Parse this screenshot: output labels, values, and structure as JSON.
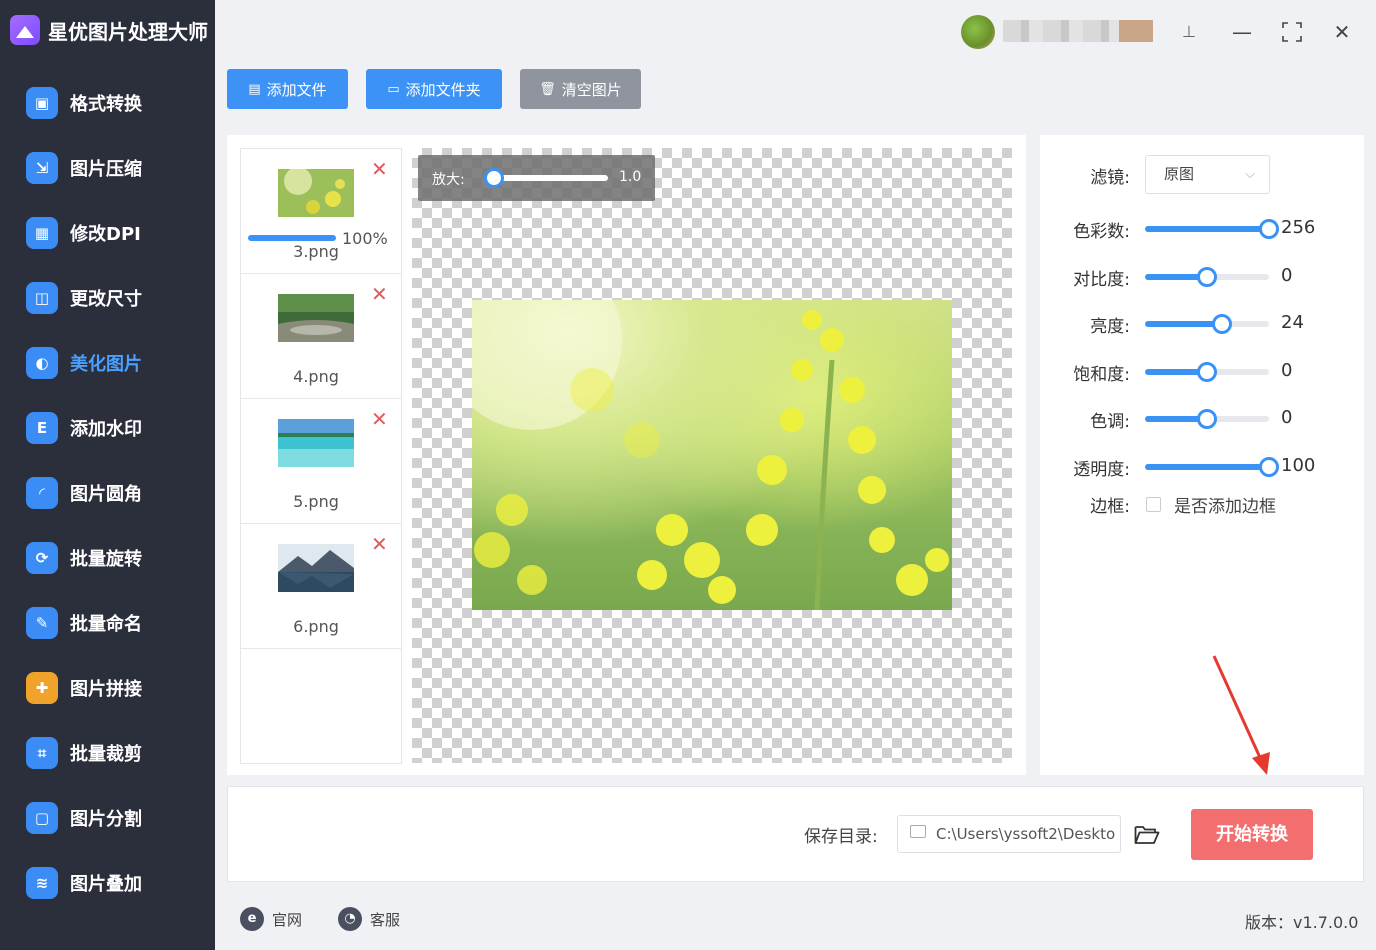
{
  "app": {
    "title": "星优图片处理大师"
  },
  "sidebar": {
    "items": [
      {
        "label": "格式转换",
        "icon": "image-convert-icon",
        "color": "#3b8df5",
        "glyph": "▣"
      },
      {
        "label": "图片压缩",
        "icon": "compress-icon",
        "color": "#3b8df5",
        "glyph": "⇲"
      },
      {
        "label": "修改DPI",
        "icon": "dpi-icon",
        "color": "#3b8df5",
        "glyph": "▦"
      },
      {
        "label": "更改尺寸",
        "icon": "resize-icon",
        "color": "#3b8df5",
        "glyph": "◫"
      },
      {
        "label": "美化图片",
        "icon": "beautify-icon",
        "color": "#3b8df5",
        "glyph": "◐"
      },
      {
        "label": "添加水印",
        "icon": "watermark-icon",
        "color": "#3b8df5",
        "glyph": "E"
      },
      {
        "label": "图片圆角",
        "icon": "rounded-corner-icon",
        "color": "#3b8df5",
        "glyph": "◜"
      },
      {
        "label": "批量旋转",
        "icon": "rotate-icon",
        "color": "#3b8df5",
        "glyph": "⟳"
      },
      {
        "label": "批量命名",
        "icon": "rename-icon",
        "color": "#3b8df5",
        "glyph": "✎"
      },
      {
        "label": "图片拼接",
        "icon": "puzzle-icon",
        "color": "#f0a32a",
        "glyph": "✚"
      },
      {
        "label": "批量裁剪",
        "icon": "crop-icon",
        "color": "#3b8df5",
        "glyph": "⌗"
      },
      {
        "label": "图片分割",
        "icon": "split-icon",
        "color": "#3b8df5",
        "glyph": "▢"
      },
      {
        "label": "图片叠加",
        "icon": "layers-icon",
        "color": "#3b8df5",
        "glyph": "≋"
      }
    ],
    "active_index": 4
  },
  "toolbar": {
    "add_file": "添加文件",
    "add_folder": "添加文件夹",
    "clear": "清空图片",
    "primary_color": "#3d93f5",
    "clear_color": "#8f949e"
  },
  "files": [
    {
      "name": "3.png",
      "progress_text": "100%",
      "progress": 1.0,
      "thumb": "flowers"
    },
    {
      "name": "4.png",
      "thumb": "river"
    },
    {
      "name": "5.png",
      "thumb": "beach"
    },
    {
      "name": "6.png",
      "thumb": "mountain"
    }
  ],
  "preview": {
    "zoom_label": "放大:",
    "zoom_value": "1.0"
  },
  "settings": {
    "filter_label": "滤镜:",
    "filter_value": "原图",
    "sliders": [
      {
        "label": "色彩数:",
        "value": "256",
        "fraction": 1.0
      },
      {
        "label": "对比度:",
        "value": "0",
        "fraction": 0.5
      },
      {
        "label": "亮度:",
        "value": "24",
        "fraction": 0.62
      },
      {
        "label": "饱和度:",
        "value": "0",
        "fraction": 0.5
      },
      {
        "label": "色调:",
        "value": "0",
        "fraction": 0.5
      },
      {
        "label": "透明度:",
        "value": "100",
        "fraction": 1.0
      }
    ],
    "border_label": "边框:",
    "border_checkbox": "是否添加边框"
  },
  "output": {
    "save_dir_label": "保存目录:",
    "save_dir_value": "C:\\Users\\yssoft2\\Deskto",
    "start_button": "开始转换",
    "start_color": "#f36e6e"
  },
  "footer": {
    "website": "官网",
    "support": "客服",
    "version": "版本：v1.7.0.0"
  },
  "window": {
    "pin": "⊥",
    "minimize": "—",
    "maximize": "⛶",
    "close": "✕"
  }
}
